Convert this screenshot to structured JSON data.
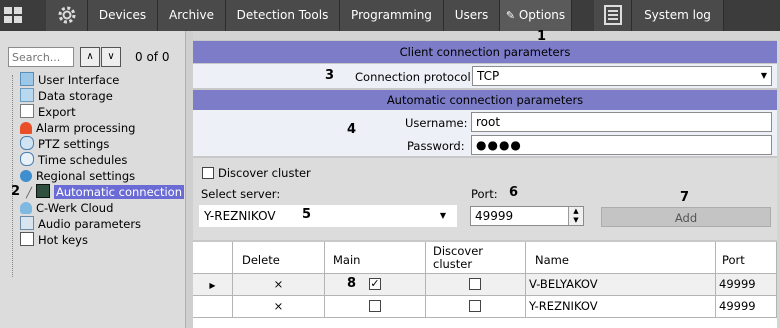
{
  "nav": {
    "tabs": [
      "Devices",
      "Archive",
      "Detection Tools",
      "Programming",
      "Users",
      "Options",
      "System log"
    ],
    "active_tab": "Options"
  },
  "sidebar": {
    "search_placeholder": "Search...",
    "search_count": "0 of 0",
    "items": [
      {
        "label": "User Interface",
        "icon": "user-interface-icon"
      },
      {
        "label": "Data storage",
        "icon": "data-storage-icon"
      },
      {
        "label": "Export",
        "icon": "export-icon"
      },
      {
        "label": "Alarm processing",
        "icon": "alarm-icon"
      },
      {
        "label": "PTZ settings",
        "icon": "ptz-icon"
      },
      {
        "label": "Time schedules",
        "icon": "clock-icon"
      },
      {
        "label": "Regional settings",
        "icon": "globe-icon"
      },
      {
        "label": "Automatic connection",
        "icon": "connection-icon",
        "selected": true
      },
      {
        "label": "C-Werk Cloud",
        "icon": "cloud-icon"
      },
      {
        "label": "Audio parameters",
        "icon": "audio-icon"
      },
      {
        "label": "Hot keys",
        "icon": "hotkeys-icon"
      }
    ]
  },
  "client": {
    "header": "Client connection parameters",
    "protocol_label": "Connection protocol",
    "protocol_value": "TCP"
  },
  "auto": {
    "header": "Automatic connection parameters",
    "username_label": "Username:",
    "username_value": "root",
    "password_label": "Password:",
    "password_value": "●●●●",
    "discover_label": "Discover cluster",
    "select_server_label": "Select server:",
    "server_value": "Y-REZNIKOV",
    "port_label": "Port:",
    "port_value": "49999",
    "add_label": "Add"
  },
  "table": {
    "columns": [
      "Delete",
      "Main",
      "Discover cluster",
      "Name",
      "Port"
    ],
    "rows": [
      {
        "delete": "×",
        "main": true,
        "discover": false,
        "name": "V-BELYAKOV",
        "port": "49999",
        "current": true
      },
      {
        "delete": "×",
        "main": false,
        "discover": false,
        "name": "Y-REZNIKOV",
        "port": "49999",
        "current": false
      }
    ]
  },
  "markers": [
    "1",
    "2",
    "3",
    "4",
    "5",
    "6",
    "7",
    "8"
  ],
  "colors": {
    "section_header": "#7c7cc8",
    "topbar": "#3c3c3c",
    "selected_item": "#6b6bd6"
  }
}
